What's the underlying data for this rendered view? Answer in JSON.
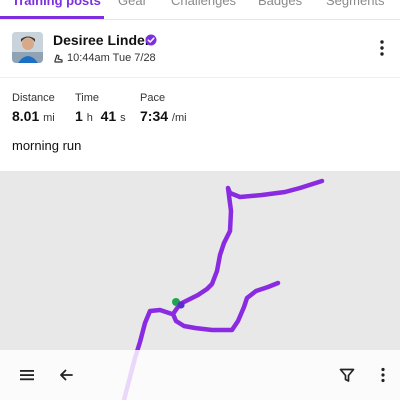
{
  "tabs": [
    {
      "label": "Training posts",
      "active": true
    },
    {
      "label": "Gear",
      "active": false
    },
    {
      "label": "Challenges",
      "active": false
    },
    {
      "label": "Badges",
      "active": false
    },
    {
      "label": "Segments",
      "active": false
    }
  ],
  "post": {
    "author": "Desiree Linden",
    "time": "10:44am Tue 7/28",
    "icons": {
      "verified": "verified-badge-icon",
      "activity": "shoe-icon",
      "menu": "more-vertical-icon"
    }
  },
  "stats": {
    "distance": {
      "label": "Distance",
      "value": "8.01",
      "unit": "mi"
    },
    "time": {
      "label": "Time",
      "hours": "1",
      "hours_unit": "h",
      "minutes": "41",
      "minutes_unit": "s"
    },
    "pace": {
      "label": "Pace",
      "value": "7:34",
      "unit": "/mi"
    }
  },
  "caption": "morning run",
  "colors": {
    "accent": "#7c2ee0",
    "route": "#8a2be2",
    "start": "#1fa64a",
    "map_bg": "#e8e8e8"
  },
  "bottom_bar": {
    "icons": [
      "menu-icon",
      "back-arrow-icon",
      "filter-icon",
      "more-vertical-icon"
    ]
  }
}
